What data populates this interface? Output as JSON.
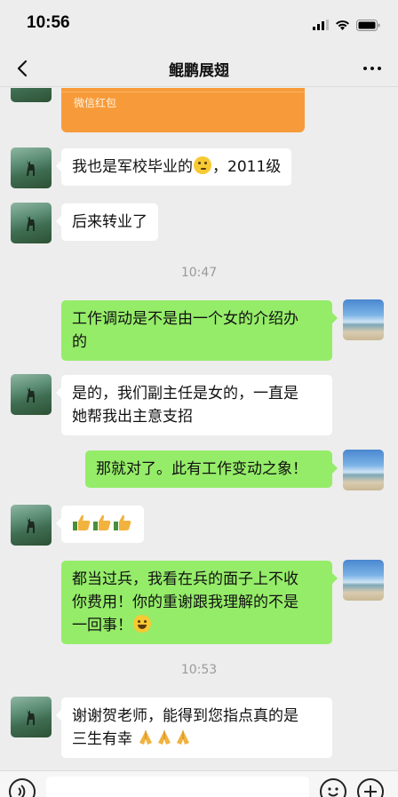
{
  "status_bar": {
    "time": "10:56"
  },
  "nav": {
    "title": "鲲鹏展翅"
  },
  "red_packet": {
    "label": "微信红包"
  },
  "messages": {
    "m1": {
      "text": "我也是军校毕业的",
      "text_after": "，2011级"
    },
    "m2": {
      "text": "后来转业了"
    },
    "time1": "10:47",
    "m3": {
      "line1": "工作调动是不是由一个女的介绍办",
      "line2": "的"
    },
    "m4": {
      "line1": "是的，我们副主任是女的，一直是",
      "line2": "她帮我出主意支招"
    },
    "m5": {
      "text": "那就对了。此有工作变动之象！"
    },
    "m6": {
      "emoji": "thumbs-up x3"
    },
    "m7": {
      "line1": "都当过兵，我看在兵的面子上不收",
      "line2": "你费用！你的重谢跟我理解的不是",
      "line3": "一回事！"
    },
    "time2": "10:53",
    "m8": {
      "line1": "谢谢贺老师，能得到您指点真的是",
      "line2": "三生有幸"
    }
  },
  "colors": {
    "my_bubble": "#95EC69",
    "friend_bubble": "#FFFFFF",
    "background": "#EDEDED",
    "red_packet": "#F79B3A"
  },
  "icons": [
    "back-chevron-icon",
    "more-dots-icon",
    "signal-icon",
    "wifi-icon",
    "battery-icon",
    "voice-icon",
    "emoji-icon",
    "plus-icon"
  ]
}
